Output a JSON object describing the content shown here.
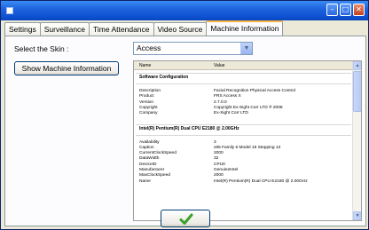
{
  "window": {
    "buttons": [
      "minimize-icon",
      "maximize-icon",
      "close-icon"
    ]
  },
  "tabs": [
    {
      "label": "Settings",
      "active": false
    },
    {
      "label": "Surveillance",
      "active": false
    },
    {
      "label": "Time Attendance",
      "active": false
    },
    {
      "label": "Video Source",
      "active": false
    },
    {
      "label": "Machine Information",
      "active": true
    }
  ],
  "skin": {
    "label": "Select the Skin :",
    "value": "Access"
  },
  "show_button_label": "Show Machine Information",
  "grid": {
    "headers": [
      "Name",
      "Value"
    ],
    "sections": [
      {
        "title": "Software Configuration",
        "rows": [
          {
            "name": "Description",
            "value": "Facial Recognition Physical Access Control"
          },
          {
            "name": "Product",
            "value": "FRS Access X"
          },
          {
            "name": "Version",
            "value": "2.7.0.0"
          },
          {
            "name": "Copyright",
            "value": "Copyright Ex-Sight Corr LTD ® 2008"
          },
          {
            "name": "Company",
            "value": "Ex-Sight Corr LTD"
          }
        ]
      },
      {
        "title": "Intel(R) Pentium(R) Dual  CPU  E2180  @ 2.00GHz",
        "rows": [
          {
            "name": "Availability",
            "value": "3"
          },
          {
            "name": "Caption",
            "value": "x86 Family 6 Model 15 Stepping 13"
          },
          {
            "name": "CurrentClockSpeed",
            "value": "2000"
          },
          {
            "name": "DataWidth",
            "value": "32"
          },
          {
            "name": "DeviceID",
            "value": "CPU0"
          },
          {
            "name": "Manufacturer",
            "value": "GenuineIntel"
          },
          {
            "name": "MaxClockSpeed",
            "value": "2000"
          },
          {
            "name": "Name",
            "value": "Intel(R) Pentium(R) Dual  CPU  E2180  @ 2.00GHz"
          }
        ]
      }
    ]
  },
  "ok_icon": "check-icon",
  "colors": {
    "titlebar": "#0b4fd0",
    "check": "#3ca02a",
    "active_tab_accent": "#f5b445"
  }
}
